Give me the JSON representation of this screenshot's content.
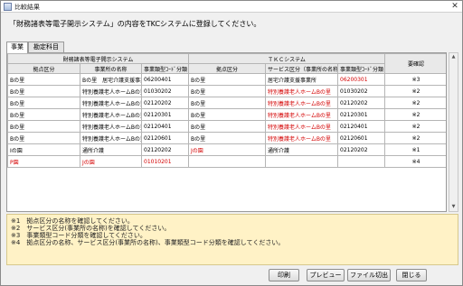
{
  "window": {
    "title": "比較結果"
  },
  "instruction": "「財務諸表等電子開示システム」の内容をTKCシステムに登録してください。",
  "tabs": [
    {
      "label": "事業"
    },
    {
      "label": "勘定科目"
    }
  ],
  "table": {
    "group_left": "財務諸表等電子開示システム",
    "group_right": "ＴＫＣシステム",
    "check_header": "要確認",
    "columns": [
      "拠点区分",
      "事業所の名称",
      "事業類型ｺｰﾄﾞ分類",
      "拠点区分",
      "サービス区分（事業所の名称）",
      "事業類型ｺｰﾄﾞ分類"
    ],
    "rows": [
      {
        "cells": [
          "Bの里",
          "Bの里　居宅介護支援事業所",
          "06200401",
          "Bの里",
          "居宅介護支援事業所",
          "06200301"
        ],
        "red": [
          false,
          false,
          false,
          false,
          false,
          true
        ],
        "check": "※3"
      },
      {
        "cells": [
          "Bの里",
          "特別養護老人ホームBの里",
          "01030202",
          "Bの里",
          "特別養護老人ホームBの里",
          "01030202"
        ],
        "red": [
          false,
          false,
          false,
          false,
          true,
          false
        ],
        "check": "※2"
      },
      {
        "cells": [
          "Bの里",
          "特別養護老人ホームBの里",
          "02120202",
          "Bの里",
          "特別養護老人ホームBの里",
          "02120202"
        ],
        "red": [
          false,
          false,
          false,
          false,
          true,
          false
        ],
        "check": "※2"
      },
      {
        "cells": [
          "Bの里",
          "特別養護老人ホームBの里",
          "02120301",
          "Bの里",
          "特別養護老人ホームBの里",
          "02120301"
        ],
        "red": [
          false,
          false,
          false,
          false,
          true,
          false
        ],
        "check": "※2"
      },
      {
        "cells": [
          "Bの里",
          "特別養護老人ホームBの里",
          "02120401",
          "Bの里",
          "特別養護老人ホームBの里",
          "02120401"
        ],
        "red": [
          false,
          false,
          false,
          false,
          true,
          false
        ],
        "check": "※2"
      },
      {
        "cells": [
          "Bの里",
          "特別養護老人ホームBの里",
          "02120601",
          "Bの里",
          "特別養護老人ホームBの里",
          "02120601"
        ],
        "red": [
          false,
          false,
          false,
          false,
          true,
          false
        ],
        "check": "※2"
      },
      {
        "cells": [
          "Iの園",
          "通所介護",
          "02120202",
          "Jの園",
          "通所介護",
          "02120202"
        ],
        "red": [
          false,
          false,
          false,
          true,
          false,
          false
        ],
        "check": "※1"
      },
      {
        "cells": [
          "P園",
          "Jの園",
          "01010201",
          "",
          "",
          ""
        ],
        "red": [
          true,
          true,
          true,
          false,
          false,
          false
        ],
        "check": "※4"
      }
    ]
  },
  "notes": [
    "※1　拠点区分の名称を確認してください。",
    "※2　サービス区分(事業所の名称)を確認してください。",
    "※3　事業類型コード分類を確認してください。",
    "※4　拠点区分の名称、サービス区分(事業所の名称)、事業類型コード分類を確認してください。"
  ],
  "buttons": {
    "print": "印刷",
    "preview": "プレビュー",
    "export": "ファイル切出",
    "close": "閉じる"
  },
  "colors": {
    "accent_red": "#d40000",
    "notes_bg": "#fff2c6"
  }
}
